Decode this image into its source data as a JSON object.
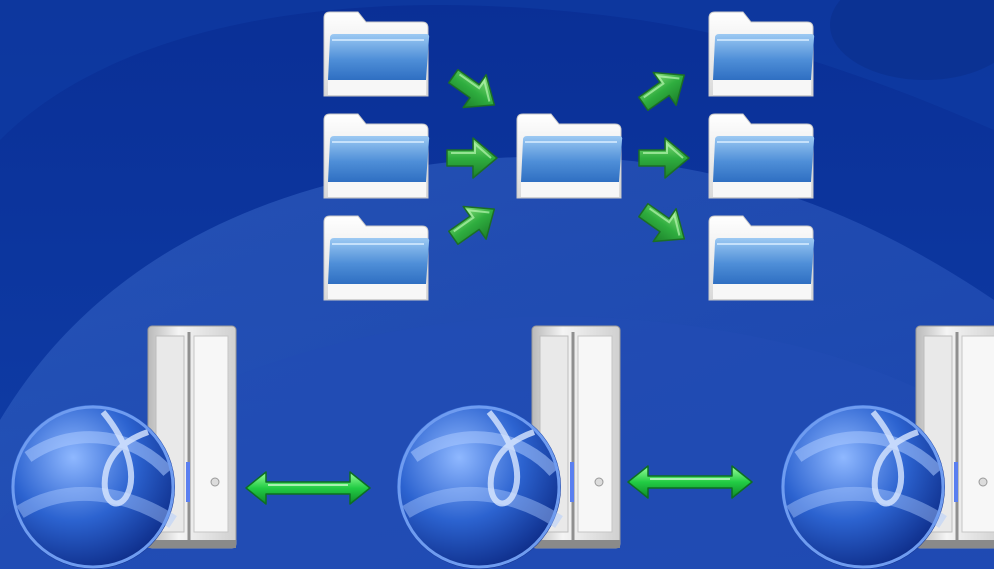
{
  "colors": {
    "background_top": "#0a2f96",
    "background_bottom": "#0f3ea8",
    "swoosh": "#2f5ec2",
    "folder_blue": "#4f8fd8",
    "folder_paper": "#f3f3f3",
    "arrow_green": "#2fae3f",
    "link_green": "#22cc44",
    "server_silver": "#e3e3e3",
    "globe_blue": "#2c63d0"
  },
  "icons": {
    "folder": "folder-icon",
    "flow_arrow": "green-arrow-icon",
    "server": "server-tower-icon",
    "globe": "globe-icon",
    "link": "double-arrow-icon"
  },
  "diagram": {
    "source_folders": 3,
    "hub_folders": 1,
    "destination_folders": 3,
    "server_nodes": 3
  }
}
